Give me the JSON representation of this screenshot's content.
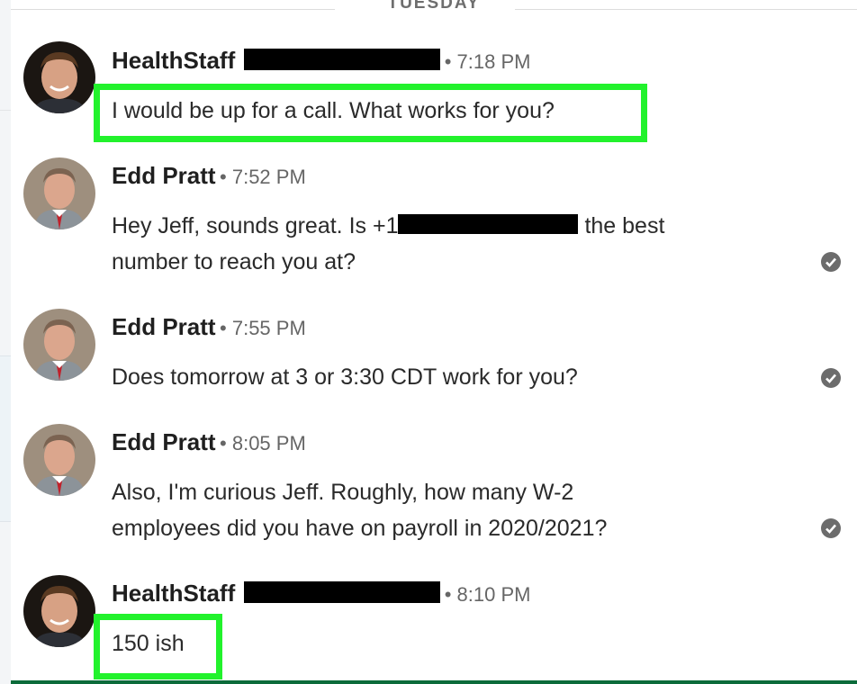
{
  "day_separator": "TUESDAY",
  "messages": [
    {
      "sender": "HealthStaff",
      "sender_suffix_redacted": true,
      "time": "• 7:18 PM",
      "lines": [
        "I would be up for a call. What works for you?"
      ],
      "highlighted": true,
      "read": false
    },
    {
      "sender": "Edd Pratt",
      "time": "• 7:52 PM",
      "lines": [
        "Hey Jeff, sounds great. Is +1",
        "the best",
        "number to reach you at?"
      ],
      "read": true
    },
    {
      "sender": "Edd Pratt",
      "time": "• 7:55 PM",
      "lines": [
        "Does tomorrow at 3 or 3:30 CDT work for you?"
      ],
      "read": true
    },
    {
      "sender": "Edd Pratt",
      "time": "• 8:05 PM",
      "lines": [
        "Also, I'm curious Jeff. Roughly, how many W-2",
        "employees did you have on payroll in 2020/2021?"
      ],
      "read": true
    },
    {
      "sender": "HealthStaff",
      "sender_suffix_redacted": true,
      "time": "• 8:10 PM",
      "lines": [
        "150 ish"
      ],
      "highlighted": true,
      "read": false
    }
  ],
  "colors": {
    "highlight": "#22f22c",
    "accent": "#0b6b3a",
    "read_check": "#6c6c6c"
  },
  "icons": {
    "read": "check-circle-icon"
  }
}
